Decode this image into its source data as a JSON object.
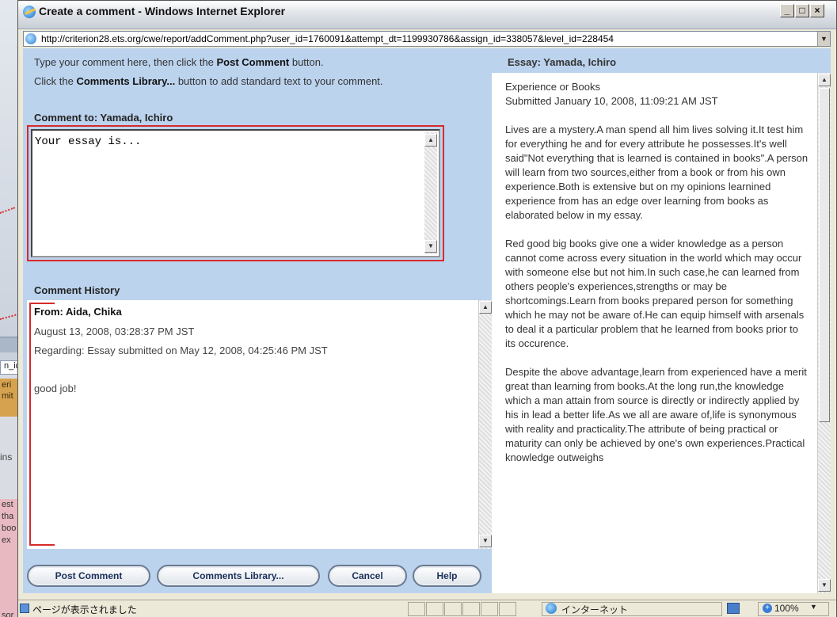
{
  "window": {
    "title": "Create a comment - Windows Internet Explorer",
    "minimize_glyph": "_",
    "maximize_glyph": "□",
    "close_glyph": "×"
  },
  "address": {
    "url": "http://criterion28.ets.org/cwe/report/addComment.php?user_id=1760091&attempt_dt=1199930786&assign_id=338057&level_id=228454",
    "dropdown_glyph": "▼"
  },
  "background_window": {
    "address_fragment": "n_id",
    "tab_lines": [
      "eri",
      "mit"
    ],
    "instr_fragment": "ins",
    "text_lines": [
      "est",
      "tha",
      "boo",
      "ex"
    ],
    "status_fragment": "sor"
  },
  "instructions": {
    "line1_pre": "Type your comment here, then click the ",
    "line1_bold": "Post Comment",
    "line1_post": " button.",
    "line2_pre": "Click the ",
    "line2_bold": "Comments Library...",
    "line2_post": " button to add standard text to your comment."
  },
  "comment": {
    "to_label": "Comment to: Yamada, Ichiro",
    "text": "Your essay is..."
  },
  "history": {
    "label": "Comment History",
    "from": "From: Aida, Chika",
    "date": "August 13, 2008, 03:28:37 PM JST",
    "regarding": "Regarding: Essay submitted on May 12, 2008, 04:25:46 PM JST",
    "body": "good job!"
  },
  "buttons": {
    "post": "Post Comment",
    "library": "Comments Library...",
    "cancel": "Cancel",
    "help": "Help"
  },
  "essay": {
    "header": "Essay: Yamada, Ichiro",
    "title": "Experience or Books",
    "submitted": "Submitted January 10, 2008, 11:09:21 AM JST",
    "paragraphs": [
      "Lives are a mystery.A man spend all him lives solving it.It test him for everything he and for every attribute he possesses.It's well said\"Not everything that is learned is contained in books\".A person will learn from two sources,either from a book or from his own experience.Both is extensive but on my opinions learnined experience from has an edge over learning from books as elaborated below in my essay.",
      "Red good big books give one a wider knowledge as a person cannot come across every situation in the world which may occur with someone else but not him.In such case,he can learned from others people's experiences,strengths or may be shortcomings.Learn from books prepared person for something which he may not be aware of.He can equip himself with arsenals to deal it a particular problem that he learned from books prior to its occurence.",
      "Despite the above advantage,learn from experienced have a merit great than learning from books.At the long run,the knowledge which a man attain from source is directly or indirectly applied by his in lead a better life.As we all are aware of,life is synonymous with reality and practicality.The attribute of being practical or maturity can only be achieved by one's own experiences.Practical knowledge outweighs"
    ]
  },
  "scroll": {
    "up_glyph": "▲",
    "down_glyph": "▼"
  },
  "status": {
    "text": "ページが表示されました",
    "zone": "インターネット",
    "zoom": "100%",
    "zoom_glyph": "+",
    "zoom_dropdown_glyph": "▼"
  }
}
